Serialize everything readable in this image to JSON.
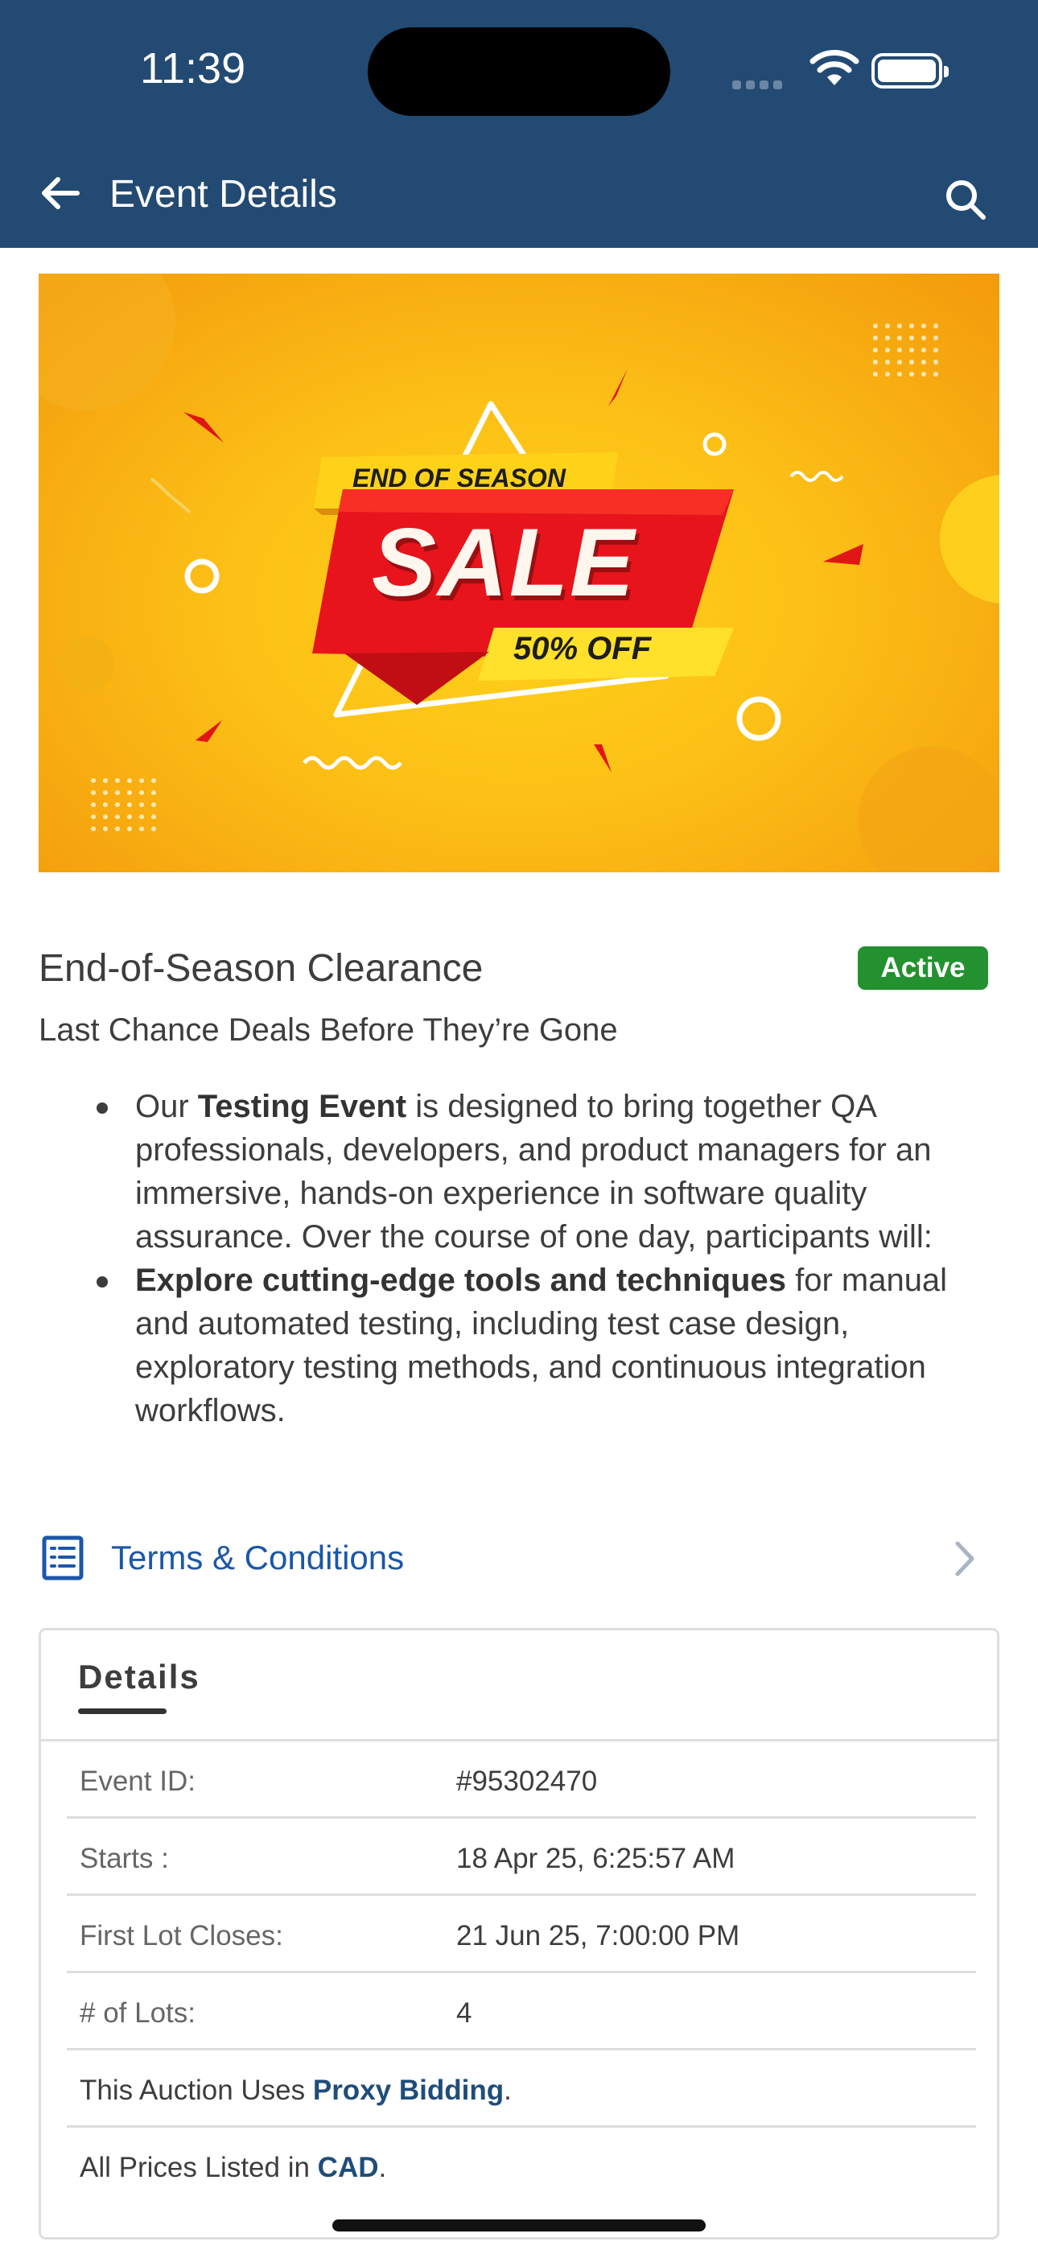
{
  "status_bar": {
    "time": "11:39"
  },
  "header": {
    "title": "Event Details"
  },
  "banner": {
    "top_text": "END OF SEASON",
    "main_text": "SALE",
    "discount_text": "50% OFF"
  },
  "event": {
    "title": "End-of-Season Clearance",
    "status": "Active",
    "subtitle": "Last Chance Deals Before They’re Gone",
    "bullets": [
      {
        "pre": "Our ",
        "bold": "Testing Event",
        "post": " is designed to bring together QA professionals, developers, and product managers for an immersive, hands-on experience in software quality assurance. Over the course of one day, participants will:"
      },
      {
        "pre": "",
        "bold": "Explore cutting-edge tools and techniques",
        "post": " for manual and automated testing, including test case design, exploratory testing methods, and continuous integration workflows."
      }
    ]
  },
  "terms": {
    "label": "Terms & Conditions"
  },
  "details": {
    "tab_label": "Details",
    "rows": [
      {
        "key": "Event ID:",
        "value": "#95302470"
      },
      {
        "key": "Starts :",
        "value": "18 Apr 25, 6:25:57 AM"
      },
      {
        "key": "First Lot Closes:",
        "value": "21 Jun 25, 7:00:00 PM"
      },
      {
        "key": "# of Lots:",
        "value": "4"
      }
    ],
    "proxy_line": {
      "pre": "This Auction Uses ",
      "link": "Proxy Bidding",
      "post": "."
    },
    "currency_line": {
      "pre": "All Prices Listed in ",
      "link": "CAD",
      "post": "."
    }
  },
  "colors": {
    "header_bg": "#234a72",
    "active_badge": "#23912f",
    "link_blue": "#1c57a8",
    "banner_red": "#e8141c",
    "banner_yellow": "#ffd21a"
  },
  "icons": [
    "back-arrow-icon",
    "search-icon",
    "wifi-icon",
    "battery-icon",
    "list-document-icon",
    "chevron-right-icon"
  ]
}
